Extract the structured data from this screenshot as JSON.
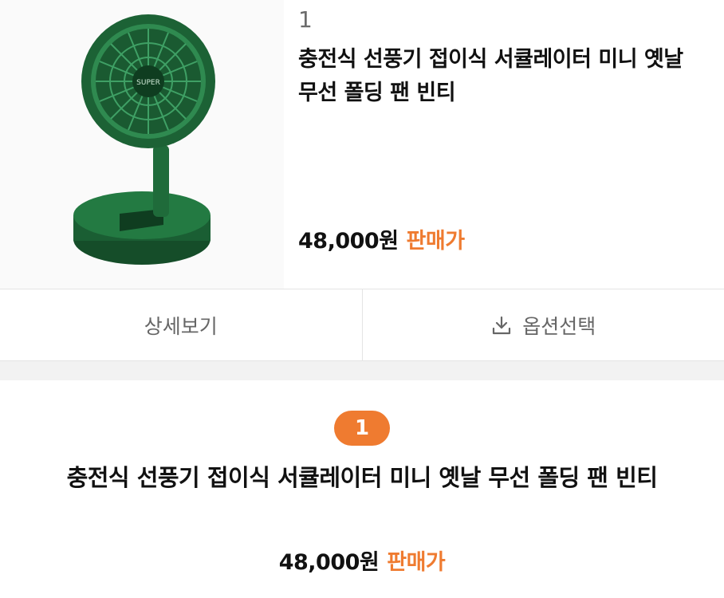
{
  "product": {
    "rank": "1",
    "title": "충전식 선풍기 접이식 서큘레이터 미니 옛날 무선 폴딩 팬 빈티",
    "price": "48,000원",
    "price_label": "판매가",
    "image_logo_text": "SUPER"
  },
  "actions": {
    "detail_label": "상세보기",
    "option_label": "옵션선택",
    "option_icon": "download-icon"
  },
  "detail": {
    "badge": "1",
    "title": "충전식 선풍기 접이식 서큘레이터 미니 옛날 무선 폴딩 팬 빈티",
    "price": "48,000원",
    "price_label": "판매가"
  },
  "colors": {
    "accent": "#ef7b30",
    "fan_green": "#1f6b3a"
  }
}
